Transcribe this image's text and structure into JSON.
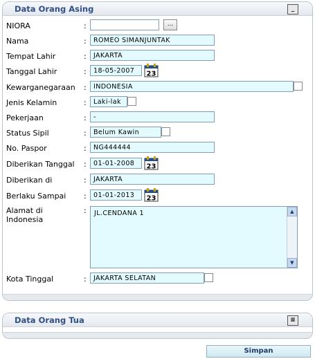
{
  "panel1": {
    "title": "Data Orang Asing",
    "collapse_glyph": "_"
  },
  "panel2": {
    "title": "Data Orang Tua",
    "expand_glyph": "≡"
  },
  "form": {
    "niora": {
      "label": "NIORA",
      "value": "",
      "lookup_label": "..."
    },
    "nama": {
      "label": "Nama",
      "value": "ROMEO SIMANJUNTAK"
    },
    "tempat_lahir": {
      "label": "Tempat Lahir",
      "value": "JAKARTA"
    },
    "tanggal_lahir": {
      "label": "Tanggal Lahir",
      "value": "18-05-2007"
    },
    "kewarganegaraan": {
      "label": "Kewarganegaraan",
      "value": "INDONESIA"
    },
    "jenis_kelamin": {
      "label": "Jenis Kelamin",
      "value": "Laki-lak"
    },
    "pekerjaan": {
      "label": "Pekerjaan",
      "value": "-"
    },
    "status_sipil": {
      "label": "Status Sipil",
      "value": "Belum Kawin"
    },
    "no_paspor": {
      "label": "No. Paspor",
      "value": "NG444444"
    },
    "diberikan_tanggal": {
      "label": "Diberikan Tanggal",
      "value": "01-01-2008"
    },
    "diberikan_di": {
      "label": "Diberikan di",
      "value": "JAKARTA"
    },
    "berlaku_sampai": {
      "label": "Berlaku Sampai",
      "value": "01-01-2013"
    },
    "alamat": {
      "label_line1": "Alamat di",
      "label_line2": "Indonesia",
      "value": "JL.CENDANA 1"
    },
    "kota_tinggal": {
      "label": "Kota Tinggal",
      "value": "JAKARTA SELATAN"
    },
    "colon": ":",
    "calendar_day": "23"
  },
  "actions": {
    "save_label": "Simpan"
  },
  "icons": {
    "calendar": "calendar-icon",
    "scroll_up": "scroll-up-icon",
    "scroll_down": "scroll-down-icon"
  },
  "colors": {
    "title": "#2f4f86",
    "field_bg": "#e3fbff",
    "border": "#7f9db9"
  }
}
